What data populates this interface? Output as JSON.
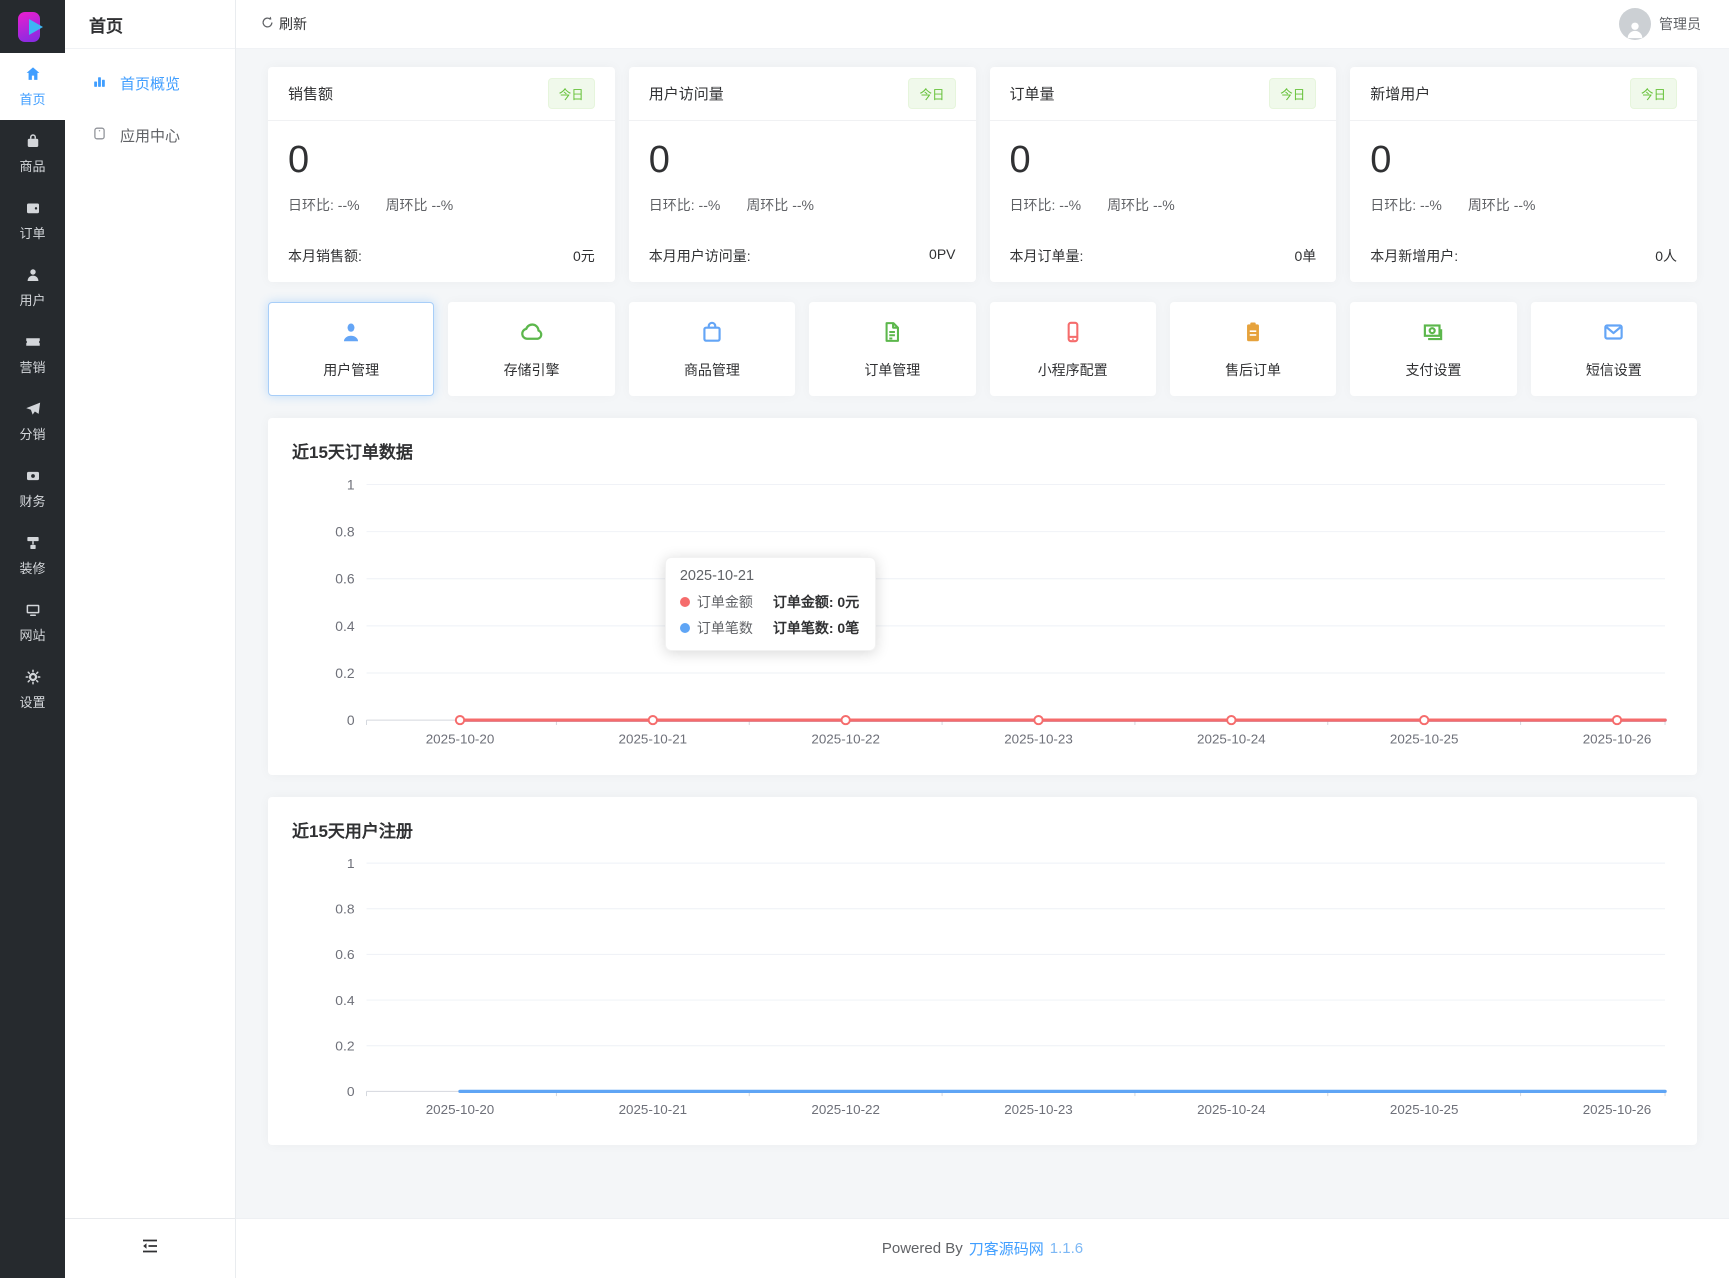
{
  "app": {
    "refresh_label": "刷新",
    "admin_label": "管理员",
    "footer": {
      "powered_by": "Powered By",
      "site_link": "刀客源码网",
      "version": "1.1.6"
    }
  },
  "rail": {
    "items": [
      {
        "label": "首页",
        "icon": "home-icon",
        "active": true
      },
      {
        "label": "商品",
        "icon": "goods-bag-icon",
        "active": false
      },
      {
        "label": "订单",
        "icon": "order-wallet-icon",
        "active": false
      },
      {
        "label": "用户",
        "icon": "user-icon",
        "active": false
      },
      {
        "label": "营销",
        "icon": "marketing-ticket-icon",
        "active": false
      },
      {
        "label": "分销",
        "icon": "distribution-plane-icon",
        "active": false
      },
      {
        "label": "财务",
        "icon": "finance-money-icon",
        "active": false
      },
      {
        "label": "装修",
        "icon": "decorate-roller-icon",
        "active": false
      },
      {
        "label": "网站",
        "icon": "website-monitor-icon",
        "active": false
      },
      {
        "label": "设置",
        "icon": "settings-gear-icon",
        "active": false
      }
    ]
  },
  "submenu": {
    "title": "首页",
    "items": [
      {
        "label": "首页概览",
        "icon": "bar-chart-icon",
        "active": true
      },
      {
        "label": "应用中心",
        "icon": "app-center-icon",
        "active": false
      }
    ]
  },
  "stats": {
    "badge": "今日",
    "cards": [
      {
        "title": "销售额",
        "value": "0",
        "day_ratio": "日环比: --%",
        "week_ratio": "周环比 --%",
        "footer_label": "本月销售额:",
        "footer_value": "0元"
      },
      {
        "title": "用户访问量",
        "value": "0",
        "day_ratio": "日环比: --%",
        "week_ratio": "周环比 --%",
        "footer_label": "本月用户访问量:",
        "footer_value": "0PV"
      },
      {
        "title": "订单量",
        "value": "0",
        "day_ratio": "日环比: --%",
        "week_ratio": "周环比 --%",
        "footer_label": "本月订单量:",
        "footer_value": "0单"
      },
      {
        "title": "新增用户",
        "value": "0",
        "day_ratio": "日环比: --%",
        "week_ratio": "周环比 --%",
        "footer_label": "本月新增用户:",
        "footer_value": "0人"
      }
    ]
  },
  "shortcuts": [
    {
      "label": "用户管理",
      "icon": "user-manage-icon",
      "color": "#64a5f6",
      "highlighted": true
    },
    {
      "label": "存储引擎",
      "icon": "cloud-storage-icon",
      "color": "#5cb74c",
      "highlighted": false
    },
    {
      "label": "商品管理",
      "icon": "shopping-bag-icon",
      "color": "#64a5f6",
      "highlighted": false
    },
    {
      "label": "订单管理",
      "icon": "document-icon",
      "color": "#5cb74c",
      "highlighted": false
    },
    {
      "label": "小程序配置",
      "icon": "phone-icon",
      "color": "#f56c6c",
      "highlighted": false
    },
    {
      "label": "售后订单",
      "icon": "clipboard-icon",
      "color": "#e6a23c",
      "highlighted": false
    },
    {
      "label": "支付设置",
      "icon": "cash-icon",
      "color": "#5cb74c",
      "highlighted": false
    },
    {
      "label": "短信设置",
      "icon": "envelope-icon",
      "color": "#64a5f6",
      "highlighted": false
    }
  ],
  "chart_data": [
    {
      "type": "line",
      "title": "近15天订单数据",
      "x": [
        "2025-10-20",
        "2025-10-21",
        "2025-10-22",
        "2025-10-23",
        "2025-10-24",
        "2025-10-25",
        "2025-10-26"
      ],
      "series": [
        {
          "name": "订单金额",
          "color": "#f56c6c",
          "values": [
            0,
            0,
            0,
            0,
            0,
            0,
            0
          ],
          "markers": true
        },
        {
          "name": "订单笔数",
          "color": "#5fa5f5",
          "values": [
            0,
            0,
            0,
            0,
            0,
            0,
            0
          ],
          "markers": false
        }
      ],
      "ylim": [
        0,
        1
      ],
      "yticks": [
        1,
        0.8,
        0.6,
        0.4,
        0.2,
        0
      ],
      "grid": true,
      "legend_position": "none",
      "tooltip": {
        "visible": true,
        "date": "2025-10-21",
        "rows": [
          {
            "dot_color": "#f56c6c",
            "series": "订单金额",
            "label": "订单金额:",
            "value": "0元"
          },
          {
            "dot_color": "#5fa5f5",
            "series": "订单笔数",
            "label": "订单笔数:",
            "value": "0笔"
          }
        ]
      }
    },
    {
      "type": "line",
      "title": "近15天用户注册",
      "x": [
        "2025-10-20",
        "2025-10-21",
        "2025-10-22",
        "2025-10-23",
        "2025-10-24",
        "2025-10-25",
        "2025-10-26"
      ],
      "series": [
        {
          "name": "用户注册",
          "color": "#5fa5f5",
          "values": [
            0,
            0,
            0,
            0,
            0,
            0,
            0
          ],
          "markers": false
        }
      ],
      "ylim": [
        0,
        1
      ],
      "yticks": [
        1,
        0.8,
        0.6,
        0.4,
        0.2,
        0
      ],
      "grid": true,
      "legend_position": "none",
      "tooltip": {
        "visible": false
      }
    }
  ]
}
